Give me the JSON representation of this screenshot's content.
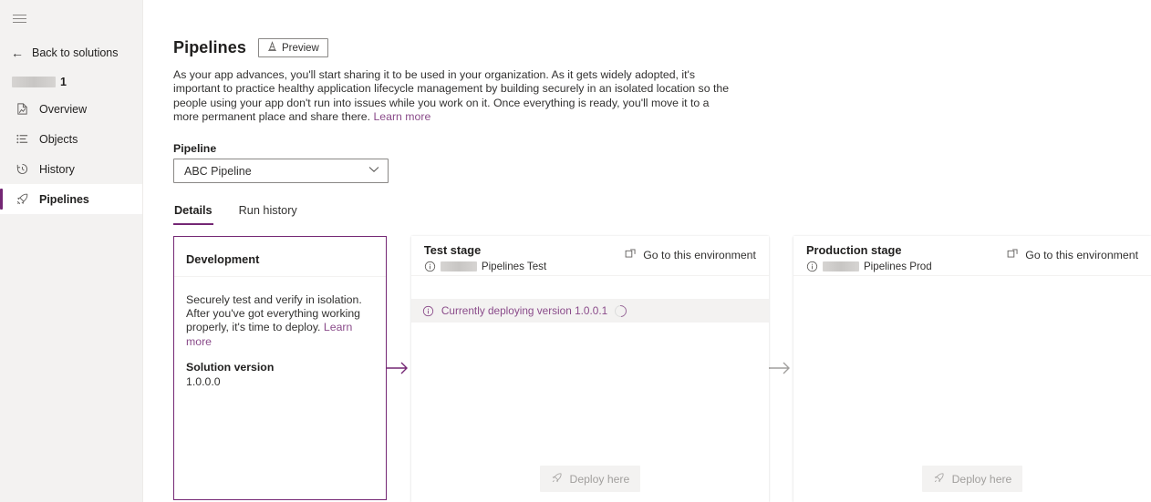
{
  "colors": {
    "accent": "#742774",
    "link": "#8a4b8a",
    "sidebar_bg": "#f3f2f1",
    "status_text": "#8a4b8a",
    "disabled_text": "#a19f9d"
  },
  "sidebar": {
    "menu_icon": "hamburger-icon",
    "back_label": "Back to solutions",
    "back_icon": "arrow-left-icon",
    "solution_name_redacted": true,
    "solution_suffix": "1",
    "items": [
      {
        "label": "Overview",
        "icon": "overview-icon",
        "active": false
      },
      {
        "label": "Objects",
        "icon": "objects-list-icon",
        "active": false
      },
      {
        "label": "History",
        "icon": "history-clock-icon",
        "active": false
      },
      {
        "label": "Pipelines",
        "icon": "rocket-icon",
        "active": true
      }
    ]
  },
  "header": {
    "title": "Pipelines",
    "preview_badge": "Preview",
    "preview_icon": "cone-icon",
    "intro_text": "As your app advances, you'll start sharing it to be used in your organization. As it gets widely adopted, it's important to practice healthy application lifecycle management by building securely in an isolated location so the people using your app don't run into issues while you work on it. Once everything is ready, you'll move it to a more permanent place and share there. ",
    "intro_link": "Learn more"
  },
  "pipeline_picker": {
    "label": "Pipeline",
    "value": "ABC Pipeline",
    "chevron_icon": "chevron-down-icon"
  },
  "tabs": [
    {
      "label": "Details",
      "active": true
    },
    {
      "label": "Run history",
      "active": false
    }
  ],
  "stages": {
    "development": {
      "title": "Development",
      "description": "Securely test and verify in isolation. After you've got everything working properly, it's time to deploy. ",
      "description_link": "Learn more",
      "version_label": "Solution version",
      "version_value": "1.0.0.0"
    },
    "test": {
      "title": "Test stage",
      "env_name": "Pipelines Test",
      "env_prefix_redacted": true,
      "env_info_icon": "info-circle-icon",
      "goto_label": "Go to this environment",
      "goto_icon": "open-in-new-icon",
      "status_icon": "info-circle-icon",
      "status_text": "Currently deploying version 1.0.0.1",
      "spinner_icon": "spinner-icon",
      "deploy_label": "Deploy here",
      "deploy_icon": "rocket-icon",
      "deploy_disabled": true
    },
    "production": {
      "title": "Production stage",
      "env_name": "Pipelines Prod",
      "env_prefix_redacted": true,
      "env_info_icon": "info-circle-icon",
      "goto_label": "Go to this environment",
      "goto_icon": "open-in-new-icon",
      "deploy_label": "Deploy here",
      "deploy_icon": "rocket-icon",
      "deploy_disabled": true
    }
  },
  "connectors": [
    {
      "name": "dev-to-test-arrow",
      "color": "#742774"
    },
    {
      "name": "test-to-prod-arrow",
      "color": "#a19f9d"
    }
  ]
}
